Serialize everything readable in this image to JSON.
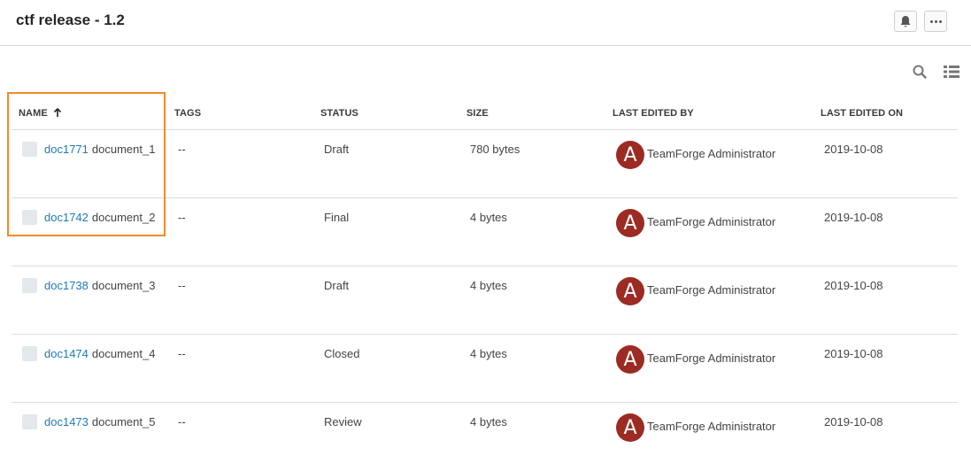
{
  "header": {
    "title": "ctf release - 1.2",
    "notifications_icon": "bell-icon",
    "more_icon": "more-horizontal-icon"
  },
  "toolbar": {
    "search_icon": "search-icon",
    "view_icon": "list-view-icon"
  },
  "table": {
    "columns": {
      "name": "NAME",
      "tags": "TAGS",
      "status": "STATUS",
      "size": "SIZE",
      "last_edited_by": "LAST EDITED BY",
      "last_edited_on": "LAST EDITED ON"
    },
    "sort": {
      "column": "name",
      "direction": "ascending"
    },
    "rows": [
      {
        "id": "doc1771",
        "name": "document_1",
        "tags": "--",
        "status": "Draft",
        "size": "780 bytes",
        "avatar_letter": "A",
        "editor": "TeamForge Administrator",
        "date": "2019-10-08"
      },
      {
        "id": "doc1742",
        "name": "document_2",
        "tags": "--",
        "status": "Final",
        "size": "4 bytes",
        "avatar_letter": "A",
        "editor": "TeamForge Administrator",
        "date": "2019-10-08"
      },
      {
        "id": "doc1738",
        "name": "document_3",
        "tags": "--",
        "status": "Draft",
        "size": "4 bytes",
        "avatar_letter": "A",
        "editor": "TeamForge Administrator",
        "date": "2019-10-08"
      },
      {
        "id": "doc1474",
        "name": "document_4",
        "tags": "--",
        "status": "Closed",
        "size": "4 bytes",
        "avatar_letter": "A",
        "editor": "TeamForge Administrator",
        "date": "2019-10-08"
      },
      {
        "id": "doc1473",
        "name": "document_5",
        "tags": "--",
        "status": "Review",
        "size": "4 bytes",
        "avatar_letter": "A",
        "editor": "TeamForge Administrator",
        "date": "2019-10-08"
      }
    ]
  },
  "colors": {
    "link": "#1f7ab3",
    "avatar_bg": "#9c2b23",
    "highlight": "#f28a2e"
  }
}
